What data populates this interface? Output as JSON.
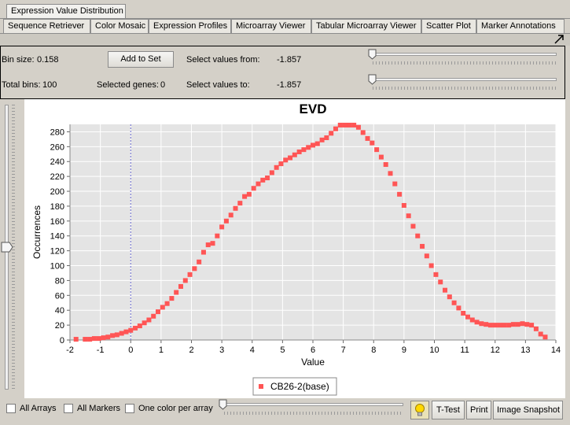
{
  "tabs_top": {
    "active": "Expression Value Distribution"
  },
  "tabs": [
    "Sequence Retriever",
    "Color Mosaic",
    "Expression Profiles",
    "Microarray Viewer",
    "Tabular Microarray Viewer",
    "Scatter Plot",
    "Marker Annotations"
  ],
  "controls": {
    "bin_size_label": "Bin size:",
    "bin_size_value": "0.158",
    "total_bins_label": "Total bins:",
    "total_bins_value": "100",
    "add_to_set_label": "Add to Set",
    "selected_genes_label": "Selected genes:",
    "selected_genes_value": "0",
    "from_label": "Select values from:",
    "from_value": "-1.857",
    "to_label": "Select values to:",
    "to_value": "-1.857"
  },
  "bottom": {
    "all_arrays": "All Arrays",
    "all_markers": "All Markers",
    "one_color": "One color per array",
    "ttest": "T-Test",
    "print": "Print",
    "snapshot": "Image Snapshot"
  },
  "icons": {
    "expand": "maximize-arrow-icon",
    "bulb": "lightbulb-icon"
  },
  "colors": {
    "series": "#ff5555",
    "plot_bg": "#e4e4e4",
    "grid": "#ffffff",
    "marker_line": "#6666cc"
  },
  "chart_data": {
    "type": "scatter",
    "title": "EVD",
    "xlabel": "Value",
    "ylabel": "Occurrences",
    "xlim": [
      -2,
      14
    ],
    "ylim": [
      0,
      290
    ],
    "xticks": [
      -2,
      -1,
      0,
      1,
      2,
      3,
      4,
      5,
      6,
      7,
      8,
      9,
      10,
      11,
      12,
      13,
      14
    ],
    "yticks": [
      0,
      20,
      40,
      60,
      80,
      100,
      120,
      140,
      160,
      180,
      200,
      220,
      240,
      260,
      280
    ],
    "threshold_x": 0,
    "legend_position": "bottom-center",
    "series": [
      {
        "name": "CB26-2(base)",
        "points": [
          [
            -1.8,
            1
          ],
          [
            -1.5,
            1
          ],
          [
            -1.35,
            1
          ],
          [
            -1.2,
            2
          ],
          [
            -1.05,
            2
          ],
          [
            -0.9,
            3
          ],
          [
            -0.75,
            4
          ],
          [
            -0.6,
            6
          ],
          [
            -0.45,
            7
          ],
          [
            -0.3,
            9
          ],
          [
            -0.15,
            11
          ],
          [
            0,
            13
          ],
          [
            0.15,
            16
          ],
          [
            0.3,
            19
          ],
          [
            0.45,
            23
          ],
          [
            0.6,
            27
          ],
          [
            0.75,
            32
          ],
          [
            0.9,
            38
          ],
          [
            1.05,
            44
          ],
          [
            1.2,
            49
          ],
          [
            1.35,
            56
          ],
          [
            1.5,
            64
          ],
          [
            1.65,
            72
          ],
          [
            1.8,
            80
          ],
          [
            1.95,
            88
          ],
          [
            2.1,
            96
          ],
          [
            2.25,
            105
          ],
          [
            2.4,
            118
          ],
          [
            2.55,
            128
          ],
          [
            2.7,
            130
          ],
          [
            2.85,
            140
          ],
          [
            3.0,
            152
          ],
          [
            3.15,
            160
          ],
          [
            3.3,
            168
          ],
          [
            3.45,
            177
          ],
          [
            3.6,
            184
          ],
          [
            3.75,
            193
          ],
          [
            3.9,
            196
          ],
          [
            4.05,
            204
          ],
          [
            4.2,
            210
          ],
          [
            4.35,
            215
          ],
          [
            4.5,
            218
          ],
          [
            4.65,
            225
          ],
          [
            4.8,
            232
          ],
          [
            4.95,
            237
          ],
          [
            5.1,
            242
          ],
          [
            5.25,
            245
          ],
          [
            5.4,
            249
          ],
          [
            5.55,
            253
          ],
          [
            5.7,
            256
          ],
          [
            5.85,
            259
          ],
          [
            6.0,
            262
          ],
          [
            6.15,
            264
          ],
          [
            6.3,
            269
          ],
          [
            6.45,
            272
          ],
          [
            6.6,
            278
          ],
          [
            6.75,
            284
          ],
          [
            6.9,
            289
          ],
          [
            7.05,
            289
          ],
          [
            7.2,
            289
          ],
          [
            7.35,
            289
          ],
          [
            7.5,
            286
          ],
          [
            7.65,
            279
          ],
          [
            7.8,
            271
          ],
          [
            7.95,
            265
          ],
          [
            8.1,
            256
          ],
          [
            8.25,
            246
          ],
          [
            8.4,
            236
          ],
          [
            8.55,
            224
          ],
          [
            8.7,
            210
          ],
          [
            8.85,
            196
          ],
          [
            9.0,
            181
          ],
          [
            9.15,
            167
          ],
          [
            9.3,
            153
          ],
          [
            9.45,
            140
          ],
          [
            9.6,
            126
          ],
          [
            9.75,
            113
          ],
          [
            9.9,
            100
          ],
          [
            10.05,
            88
          ],
          [
            10.2,
            78
          ],
          [
            10.35,
            67
          ],
          [
            10.5,
            58
          ],
          [
            10.65,
            50
          ],
          [
            10.8,
            43
          ],
          [
            10.95,
            36
          ],
          [
            11.1,
            31
          ],
          [
            11.25,
            27
          ],
          [
            11.4,
            24
          ],
          [
            11.55,
            22
          ],
          [
            11.7,
            21
          ],
          [
            11.85,
            20
          ],
          [
            12.0,
            20
          ],
          [
            12.15,
            20
          ],
          [
            12.3,
            20
          ],
          [
            12.45,
            20
          ],
          [
            12.6,
            21
          ],
          [
            12.75,
            21
          ],
          [
            12.9,
            22
          ],
          [
            13.05,
            21
          ],
          [
            13.2,
            20
          ],
          [
            13.35,
            15
          ],
          [
            13.5,
            8
          ],
          [
            13.65,
            4
          ]
        ]
      }
    ]
  }
}
